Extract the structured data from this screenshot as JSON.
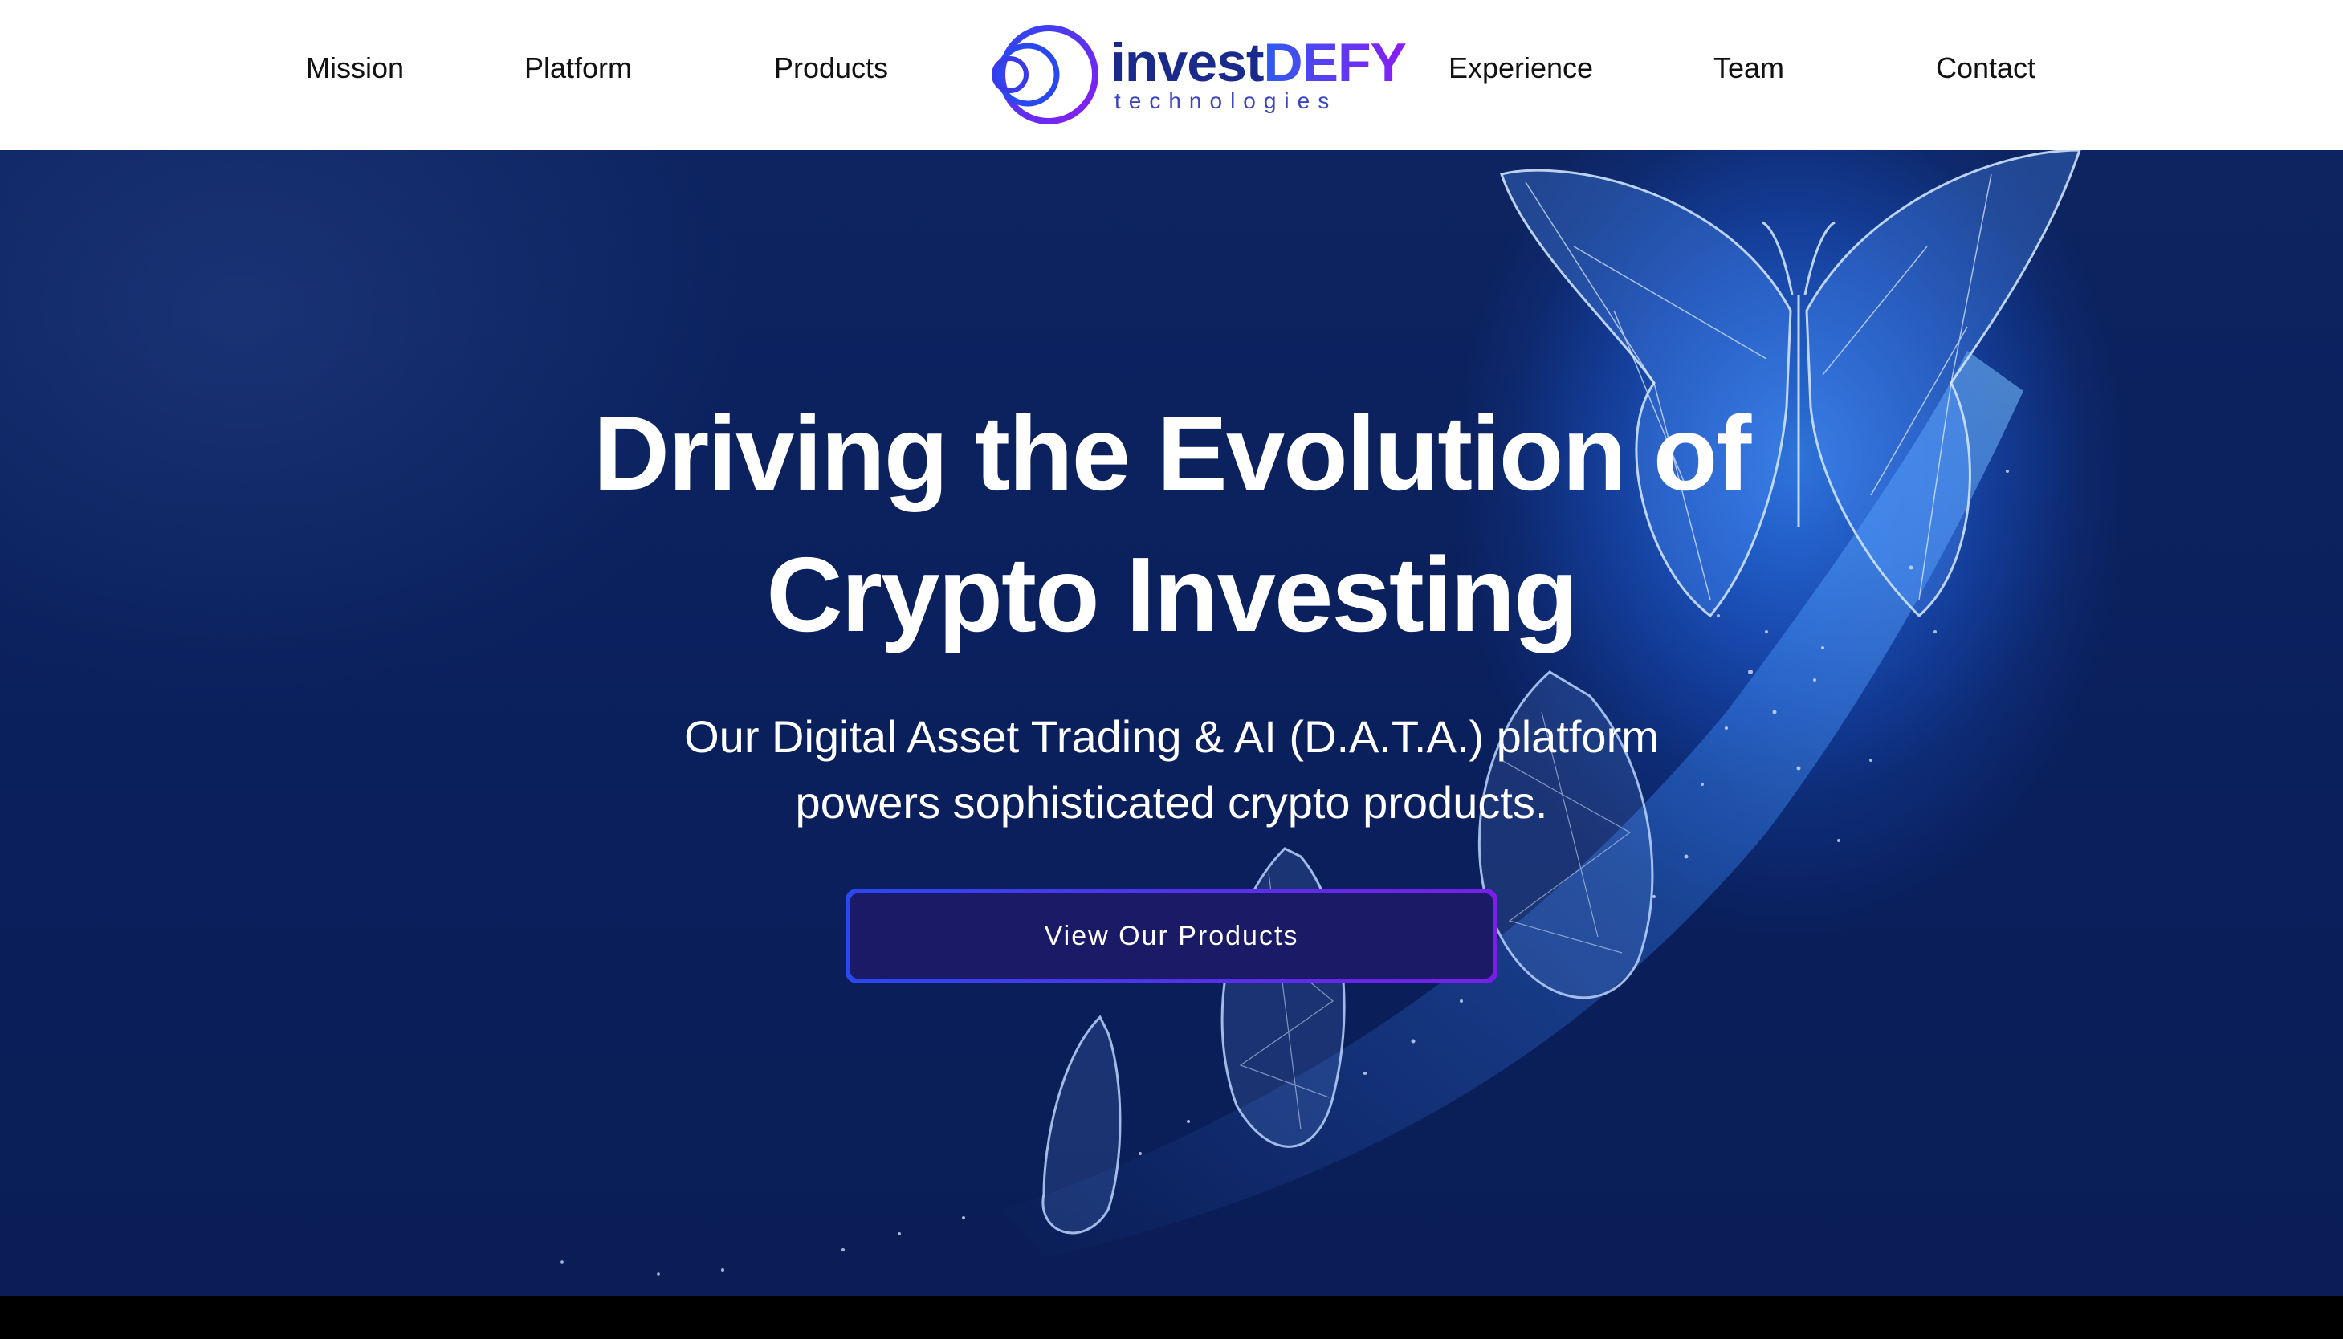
{
  "nav": {
    "items": [
      {
        "label": "Mission"
      },
      {
        "label": "Platform"
      },
      {
        "label": "Products"
      },
      {
        "label": "Experience"
      },
      {
        "label": "Team"
      },
      {
        "label": "Contact"
      }
    ]
  },
  "logo": {
    "word_part1": "invest",
    "word_part2": "DEFY",
    "subtitle": "technologies",
    "icon": "concentric-circles-logo-icon"
  },
  "hero": {
    "headline_line1": "Driving the Evolution of",
    "headline_line2": "Crypto Investing",
    "subhead_line1": "Our Digital Asset Trading & AI (D.A.T.A.) platform",
    "subhead_line2": "powers sophisticated crypto products.",
    "cta_label": "View Our Products",
    "illustration": "butterfly-metamorphosis-illustration"
  },
  "colors": {
    "hero_bg": "#0a1f5c",
    "accent_blue": "#2e5cf0",
    "accent_purple": "#8a1cf2",
    "cta_bg": "#1a1a66",
    "header_bg": "#ffffff",
    "nav_text": "#111111"
  }
}
